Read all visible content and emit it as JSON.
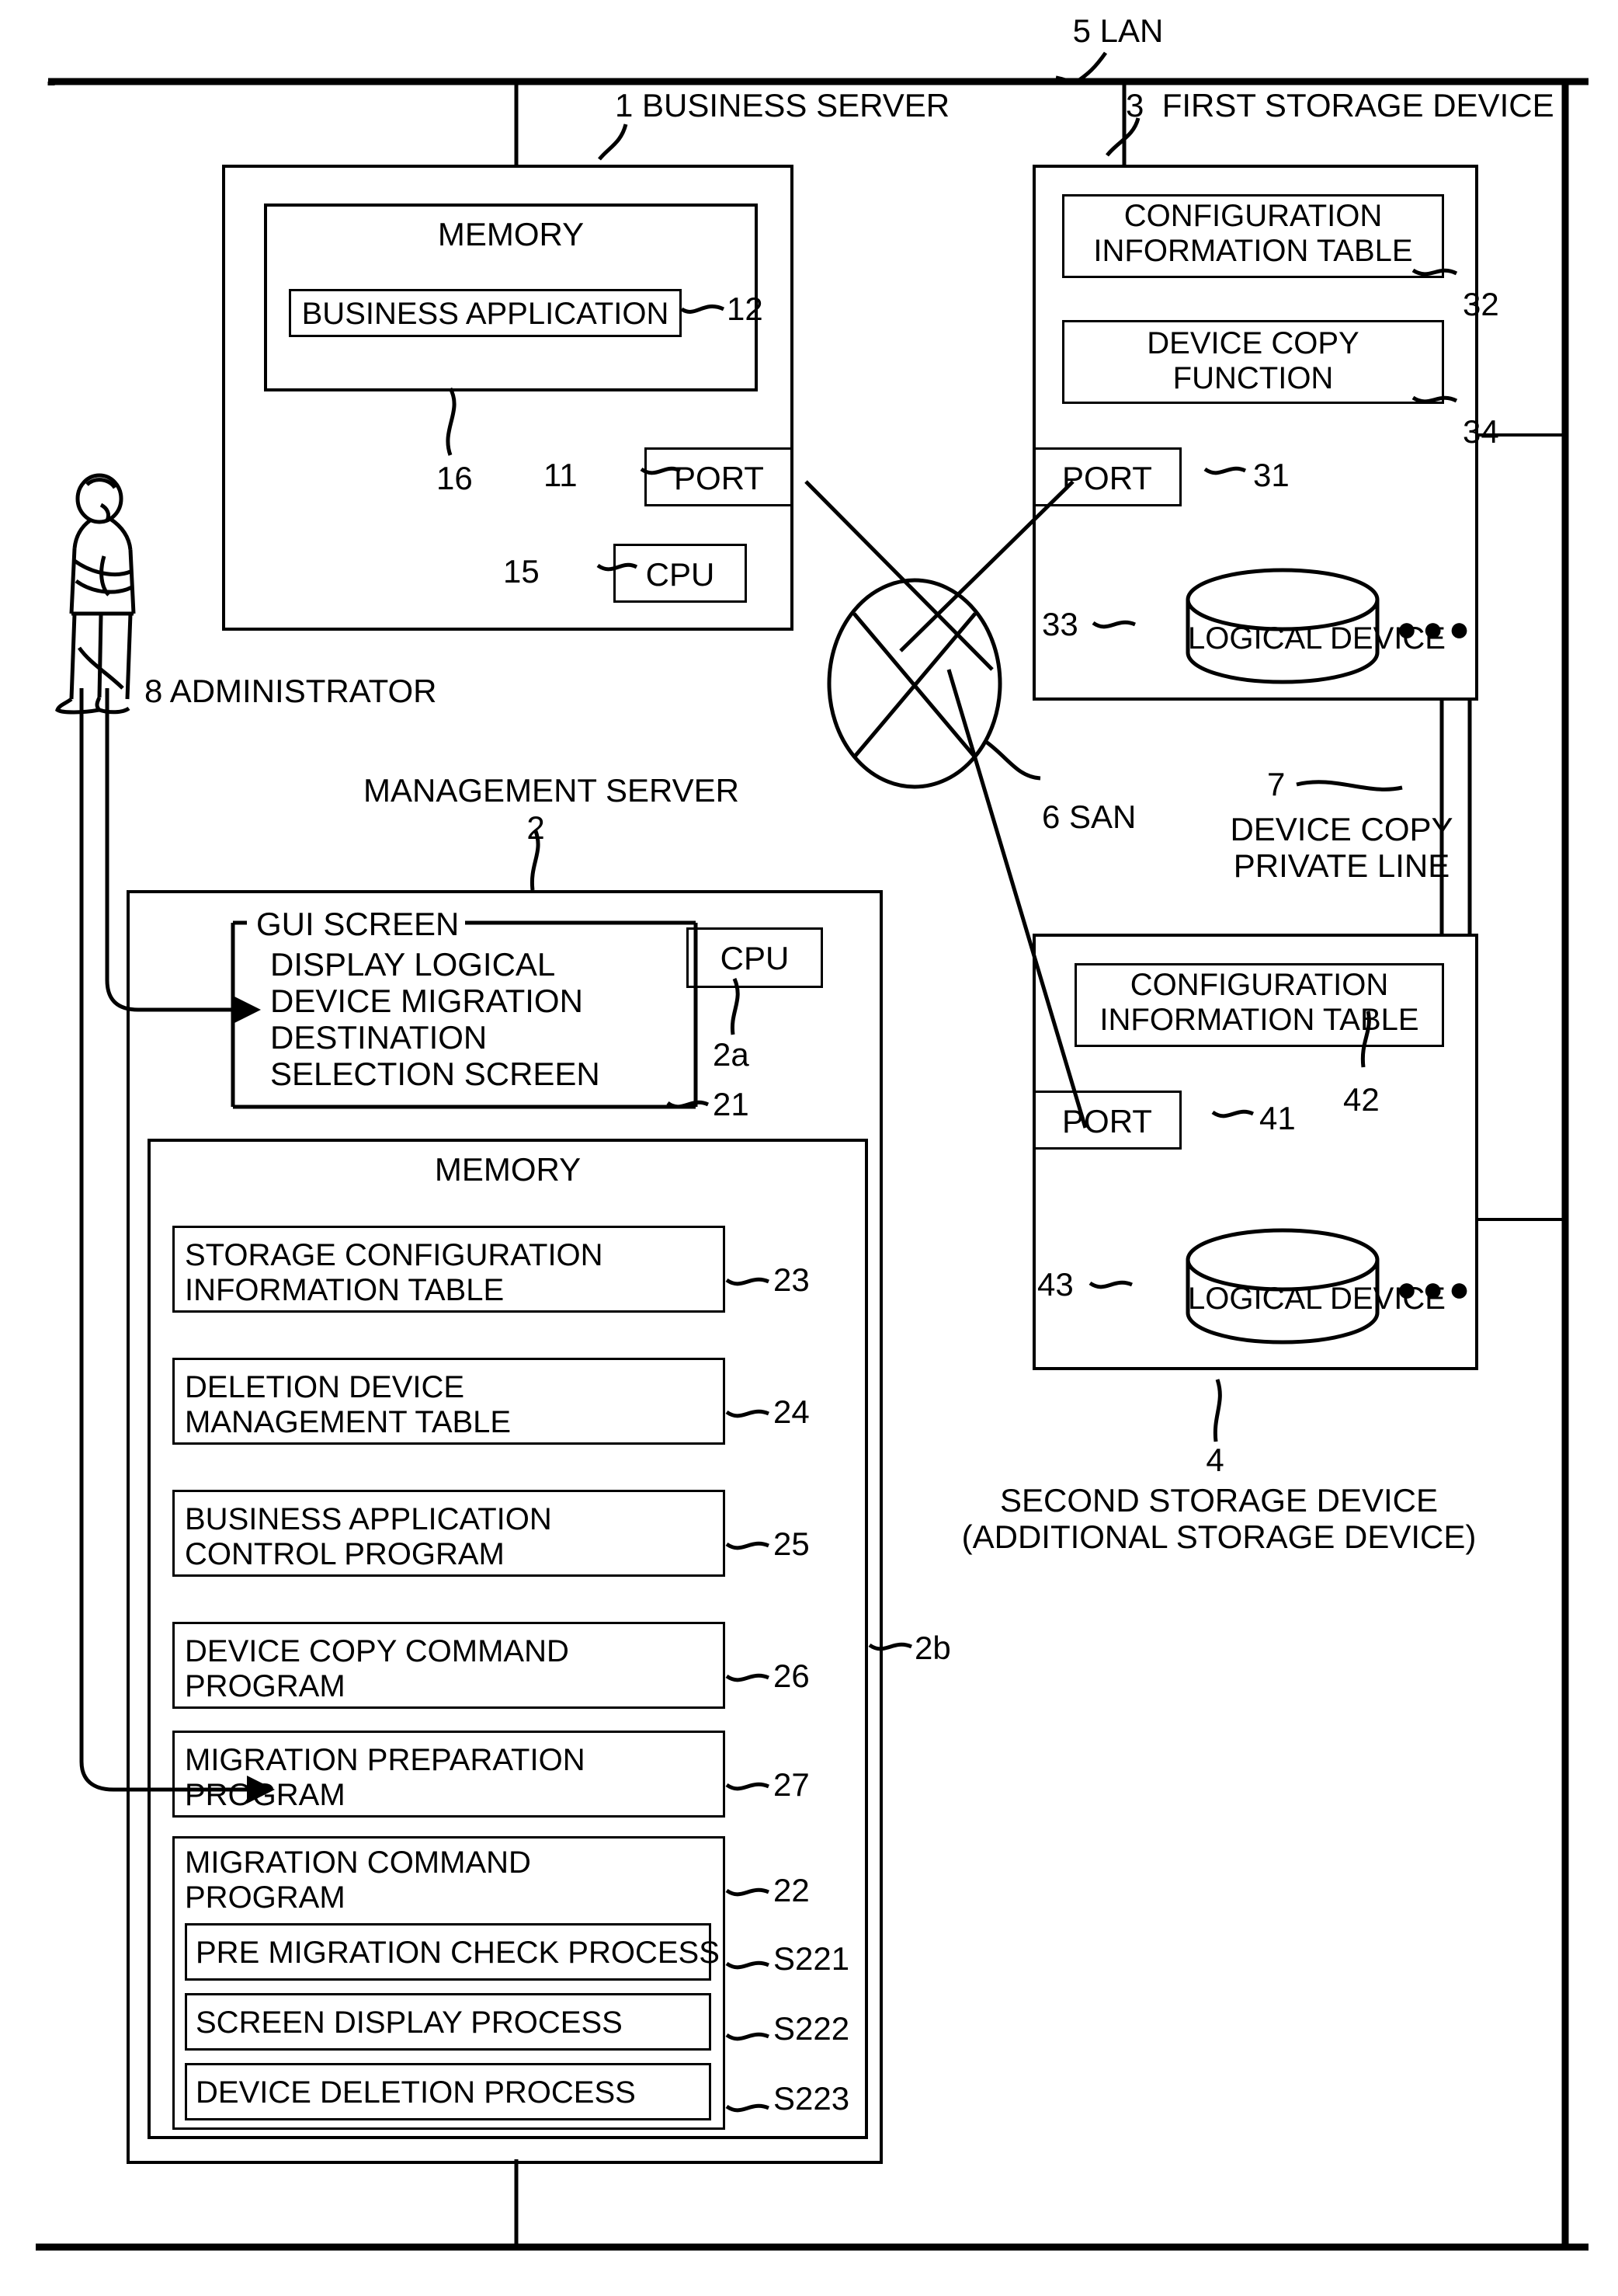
{
  "figure": {
    "network": {
      "lan_label": "5 LAN",
      "san_label": "6 SAN",
      "private_line_number": "7",
      "private_line_label": "DEVICE COPY\nPRIVATE LINE"
    },
    "actor": {
      "label": "8 ADMINISTRATOR"
    },
    "business_server": {
      "title": "1 BUSINESS SERVER",
      "memory_label": "MEMORY",
      "memory_ref": "16",
      "business_application": "BUSINESS APPLICATION",
      "business_application_ref": "12",
      "port_label": "PORT",
      "port_ref": "11",
      "cpu_label": "CPU",
      "cpu_ref": "15"
    },
    "first_storage": {
      "title": "3  FIRST STORAGE DEVICE",
      "config_table": "CONFIGURATION\nINFORMATION TABLE",
      "config_table_ref": "32",
      "device_copy_function": "DEVICE COPY\nFUNCTION",
      "device_copy_function_ref": "34",
      "port_label": "PORT",
      "port_ref": "31",
      "logical_device": "LOGICAL DEVICE",
      "logical_device_ref": "33",
      "ellipsis": "●●●"
    },
    "second_storage": {
      "caption_ref": "4",
      "caption": "SECOND STORAGE DEVICE\n(ADDITIONAL STORAGE DEVICE)",
      "config_table": "CONFIGURATION\nINFORMATION TABLE",
      "config_table_ref": "42",
      "port_label": "PORT",
      "port_ref": "41",
      "logical_device": "LOGICAL DEVICE",
      "logical_device_ref": "43",
      "ellipsis": "●●●"
    },
    "management_server": {
      "title": "MANAGEMENT SERVER",
      "title_ref": "2",
      "cpu_label": "CPU",
      "cpu_ref": "2a",
      "gui_screen_label": "GUI SCREEN",
      "gui_screen_body": "DISPLAY LOGICAL\nDEVICE MIGRATION\nDESTINATION\nSELECTION SCREEN",
      "gui_screen_ref": "21",
      "memory_label": "MEMORY",
      "memory_ref": "2b",
      "memory_items": [
        {
          "label": "STORAGE CONFIGURATION\nINFORMATION TABLE",
          "ref": "23"
        },
        {
          "label": "DELETION DEVICE\nMANAGEMENT TABLE",
          "ref": "24"
        },
        {
          "label": "BUSINESS APPLICATION\nCONTROL PROGRAM",
          "ref": "25"
        },
        {
          "label": "DEVICE COPY COMMAND\nPROGRAM",
          "ref": "26"
        },
        {
          "label": "MIGRATION PREPARATION\nPROGRAM",
          "ref": "27"
        }
      ],
      "migration_command_program": {
        "label": "MIGRATION COMMAND\nPROGRAM",
        "ref": "22"
      },
      "migration_subprocesses": [
        {
          "label": "PRE MIGRATION CHECK PROCESS",
          "ref": "S221"
        },
        {
          "label": "SCREEN DISPLAY PROCESS",
          "ref": "S222"
        },
        {
          "label": "DEVICE DELETION PROCESS",
          "ref": "S223"
        }
      ]
    }
  }
}
